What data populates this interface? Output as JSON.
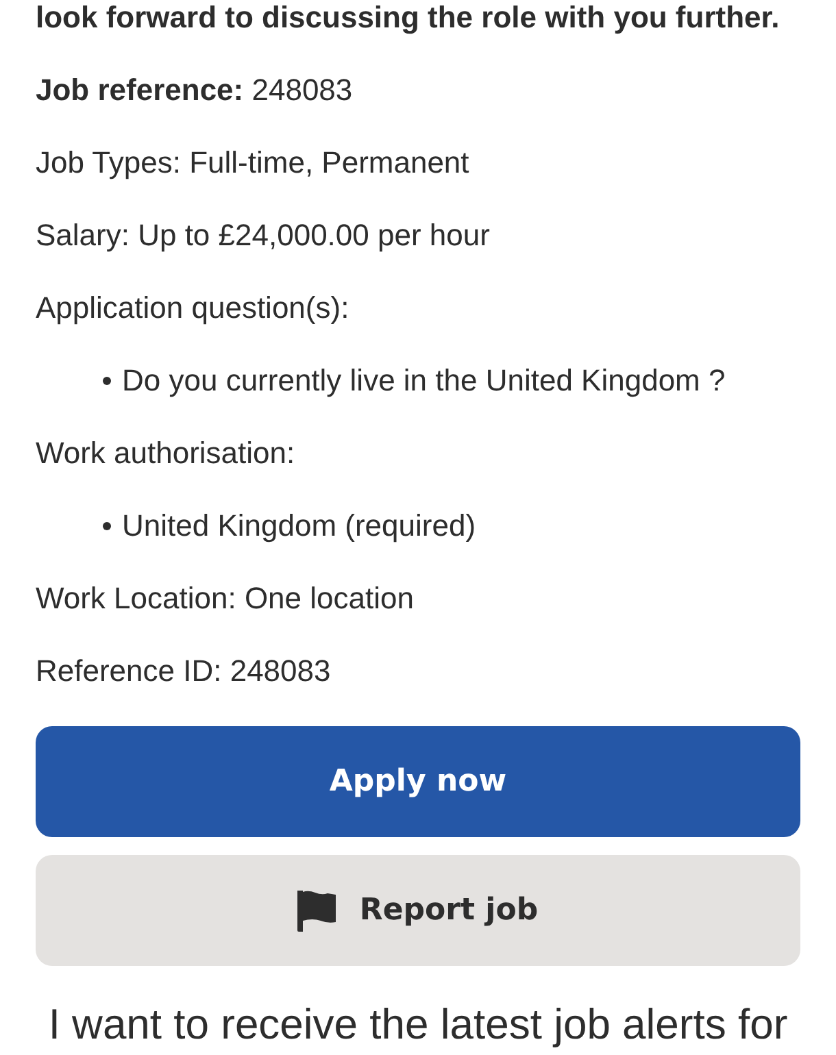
{
  "intro_tail": "look forward to discussing the role with you further.",
  "details": [
    {
      "kind": "paragraph",
      "text": "**Job reference:** 248083"
    },
    {
      "kind": "paragraph",
      "text": "Job Types: Full-time, Permanent"
    },
    {
      "kind": "paragraph",
      "text": "Salary: Up to £24,000.00 per hour"
    },
    {
      "kind": "paragraph",
      "text": "Application question(s):"
    },
    {
      "kind": "bullets",
      "items": [
        "Do you currently live in the United Kingdom ?"
      ]
    },
    {
      "kind": "paragraph",
      "text": "Work authorisation:"
    },
    {
      "kind": "bullets",
      "items": [
        "United Kingdom (required)"
      ]
    },
    {
      "kind": "paragraph",
      "text": "Work Location: One location"
    },
    {
      "kind": "paragraph",
      "text": "Reference ID: 248083"
    }
  ],
  "buttons": [
    {
      "kind": "primary",
      "label": "Apply now"
    },
    {
      "kind": "secondary",
      "label": "Report job"
    }
  ],
  "alerts_text": "I want to receive the latest job alerts for"
}
